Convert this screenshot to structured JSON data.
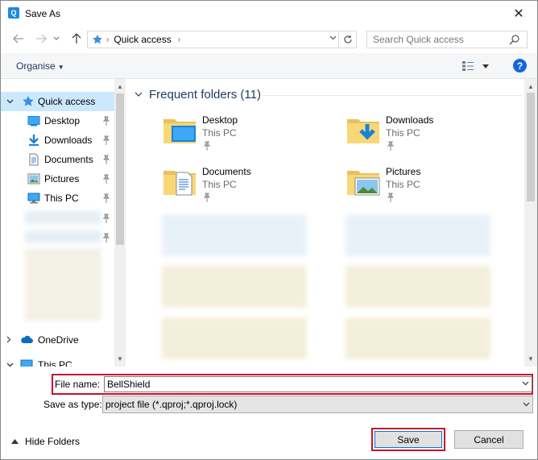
{
  "window": {
    "title": "Save As",
    "app_icon": "qgis-app-icon",
    "close_glyph": "✕"
  },
  "address_bar": {
    "back_icon": "back-arrow-icon",
    "forward_icon": "forward-arrow-icon",
    "recent_icon": "chevron-down-icon",
    "up_icon": "up-arrow-icon",
    "location": "Quick access",
    "refresh_icon": "refresh-icon"
  },
  "search": {
    "placeholder": "Search Quick access"
  },
  "toolbar": {
    "organise_label": "Organise"
  },
  "nav_pane": {
    "items": [
      {
        "label": "Quick access",
        "icon": "star-icon",
        "selected": true
      },
      {
        "label": "Desktop",
        "icon": "desktop-icon",
        "pinned": true
      },
      {
        "label": "Downloads",
        "icon": "downloads-icon",
        "pinned": true
      },
      {
        "label": "Documents",
        "icon": "documents-icon",
        "pinned": true
      },
      {
        "label": "Pictures",
        "icon": "pictures-icon",
        "pinned": true
      },
      {
        "label": "This PC",
        "icon": "computer-icon",
        "pinned": true
      },
      {
        "label": "OneDrive",
        "icon": "cloud-icon"
      },
      {
        "label": "This PC",
        "icon": "computer-icon"
      }
    ]
  },
  "main_pane": {
    "group_title": "Frequent folders (11)",
    "folders": [
      {
        "name": "Desktop",
        "location": "This PC",
        "icon": "desktop-folder-icon"
      },
      {
        "name": "Downloads",
        "location": "This PC",
        "icon": "downloads-folder-icon"
      },
      {
        "name": "Documents",
        "location": "This PC",
        "icon": "documents-folder-icon"
      },
      {
        "name": "Pictures",
        "location": "This PC",
        "icon": "pictures-folder-icon"
      }
    ]
  },
  "fields": {
    "file_name_label": "File name:",
    "file_name_value": "BellShield",
    "save_type_label": "Save as type:",
    "save_type_value": "project file (*.qproj;*.qproj.lock)"
  },
  "footer": {
    "hide_folders_label": "Hide Folders",
    "save_label": "Save",
    "cancel_label": "Cancel"
  },
  "colors": {
    "accent": "#0078d7",
    "selection": "#cce8ff",
    "highlight_outline": "#c8102e",
    "group_title": "#1e395b",
    "folder_yellow": "#f8d775"
  }
}
